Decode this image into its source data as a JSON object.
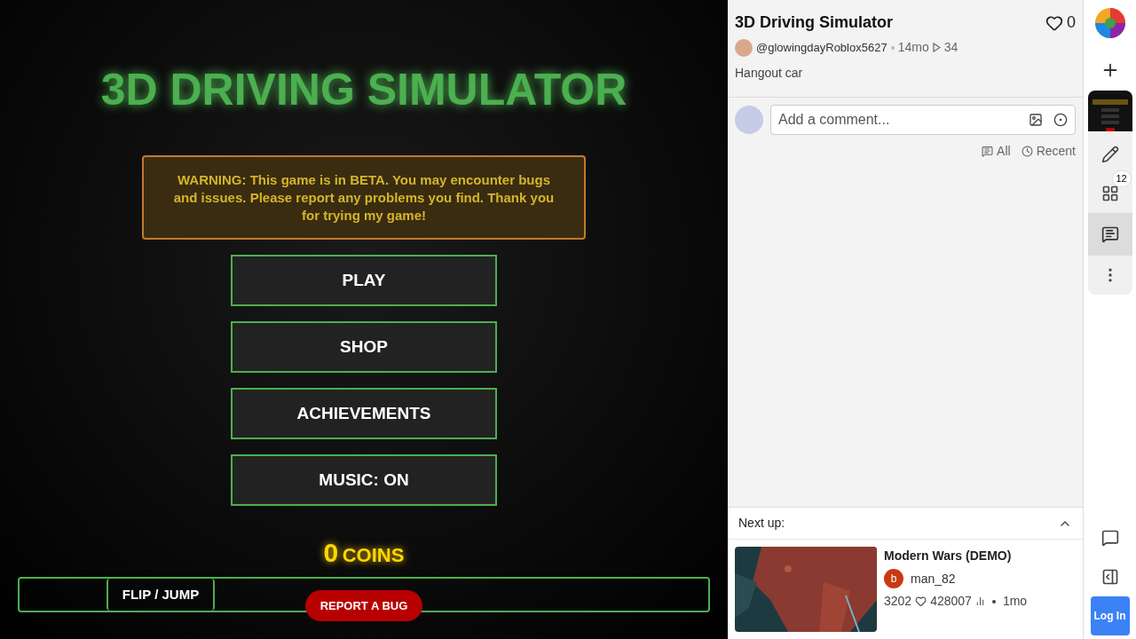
{
  "game": {
    "title": "3D DRIVING SIMULATOR",
    "warning": "WARNING: This game is in BETA. You may encounter bugs and issues. Please report any problems you find. Thank you for trying my game!",
    "menu": [
      "PLAY",
      "SHOP",
      "ACHIEVEMENTS",
      "MUSIC: ON"
    ],
    "coins": {
      "count": "0",
      "label": "COINS"
    },
    "controls": {
      "flip": "FLIP / JUMP",
      "report": "REPORT A BUG"
    }
  },
  "post": {
    "title": "3D Driving Simulator",
    "likes": "0",
    "author": "@glowingdayRoblox5627",
    "age": "14mo",
    "plays": "34",
    "description": "Hangout car"
  },
  "comments": {
    "placeholder": "Add a comment...",
    "filters": [
      {
        "label": "All"
      },
      {
        "label": "Recent"
      }
    ]
  },
  "next_up": {
    "heading": "Next up:",
    "item": {
      "kind": "picture",
      "title": "Modern Wars (DEMO)",
      "author_initial": "b",
      "author": "man_82",
      "likes": "3202",
      "views": "428007",
      "age": "1mo"
    }
  },
  "rail": {
    "badge": "12",
    "login": "Log In"
  }
}
